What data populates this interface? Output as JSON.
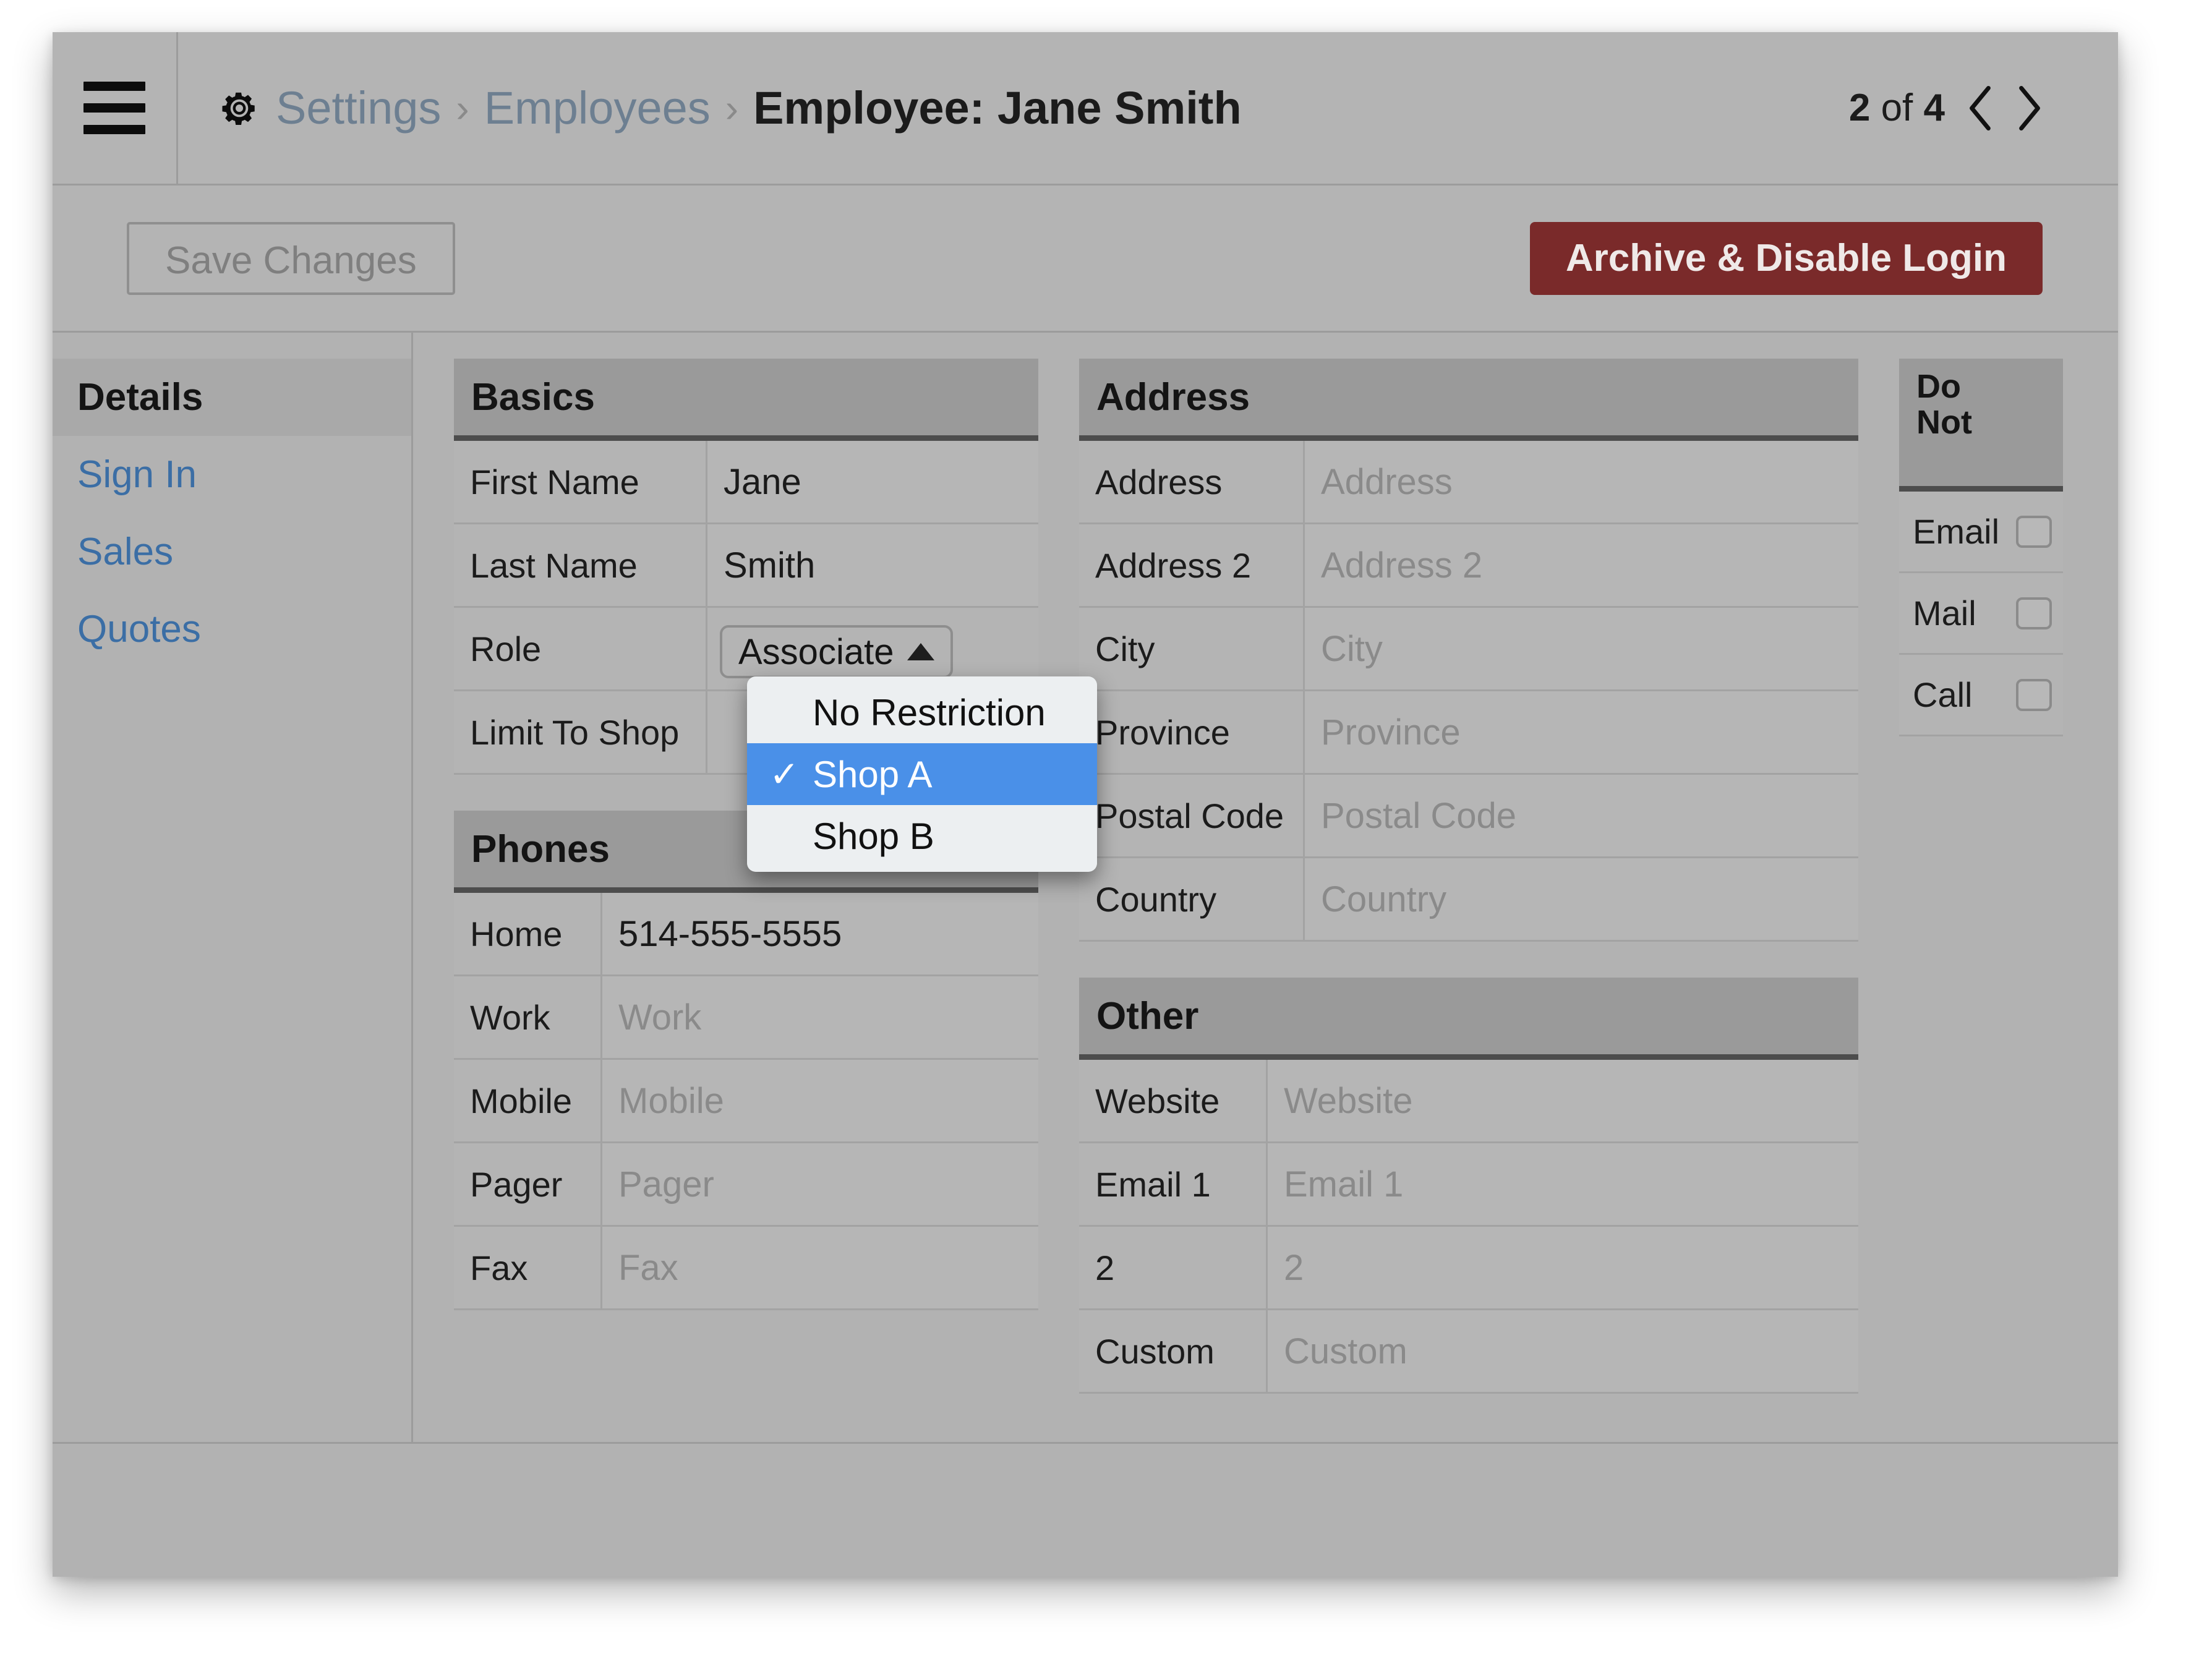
{
  "titlebar": {
    "menu_icon": "hamburger-icon",
    "gear_icon": "gear-icon",
    "breadcrumb": [
      {
        "label": "Settings",
        "type": "link"
      },
      {
        "label": "Employees",
        "type": "link"
      }
    ],
    "separator": "›",
    "current": "Employee: Jane Smith",
    "pager_prefix": "2",
    "pager_mid": " of ",
    "pager_suffix": "4",
    "prev_icon": "chevron-left-icon",
    "next_icon": "chevron-right-icon"
  },
  "actionbar": {
    "save_label": "Save Changes",
    "save_disabled": true,
    "archive_label": "Archive & Disable Login",
    "archive_color": "#7a2a2a"
  },
  "sidebar": {
    "items": [
      {
        "label": "Details",
        "active": true
      },
      {
        "label": "Sign In",
        "active": false
      },
      {
        "label": "Sales",
        "active": false
      },
      {
        "label": "Quotes",
        "active": false
      }
    ],
    "link_color": "#3b6ea5"
  },
  "panels": {
    "basics": {
      "title": "Basics",
      "rows": [
        {
          "label": "First Name",
          "value": "Jane",
          "placeholder": false
        },
        {
          "label": "Last Name",
          "value": "Smith",
          "placeholder": false
        },
        {
          "label": "Role",
          "value": "Associate",
          "type": "select"
        },
        {
          "label": "Limit To Shop",
          "value": "",
          "type": "select-open"
        }
      ]
    },
    "phones": {
      "title": "Phones",
      "rows": [
        {
          "label": "Home",
          "value": "514-555-5555",
          "placeholder": false
        },
        {
          "label": "Work",
          "value": "Work",
          "placeholder": true
        },
        {
          "label": "Mobile",
          "value": "Mobile",
          "placeholder": true
        },
        {
          "label": "Pager",
          "value": "Pager",
          "placeholder": true
        },
        {
          "label": "Fax",
          "value": "Fax",
          "placeholder": true
        }
      ]
    },
    "address": {
      "title": "Address",
      "rows": [
        {
          "label": "Address",
          "value": "Address",
          "placeholder": true
        },
        {
          "label": "Address 2",
          "value": "Address 2",
          "placeholder": true
        },
        {
          "label": "City",
          "value": "City",
          "placeholder": true
        },
        {
          "label": "Province",
          "value": "Province",
          "placeholder": true
        },
        {
          "label": "Postal Code",
          "value": "Postal Code",
          "placeholder": true
        },
        {
          "label": "Country",
          "value": "Country",
          "placeholder": true
        }
      ]
    },
    "other": {
      "title": "Other",
      "rows": [
        {
          "label": "Website",
          "value": "Website",
          "placeholder": true
        },
        {
          "label": "Email 1",
          "value": "Email 1",
          "placeholder": true
        },
        {
          "label": "2",
          "value": "2",
          "placeholder": true
        },
        {
          "label": "Custom",
          "value": "Custom",
          "placeholder": true
        }
      ]
    },
    "do_not": {
      "title_line1": "Do",
      "title_line2": "Not",
      "rows": [
        {
          "label": "Email",
          "checked": false
        },
        {
          "label": "Mail",
          "checked": false
        },
        {
          "label": "Call",
          "checked": false
        }
      ]
    }
  },
  "dropdown": {
    "open": true,
    "highlight_color": "#4a90e8",
    "check_glyph": "✓",
    "options": [
      {
        "label": "No Restriction",
        "selected": false
      },
      {
        "label": "Shop A",
        "selected": true
      },
      {
        "label": "Shop B",
        "selected": false
      }
    ]
  }
}
